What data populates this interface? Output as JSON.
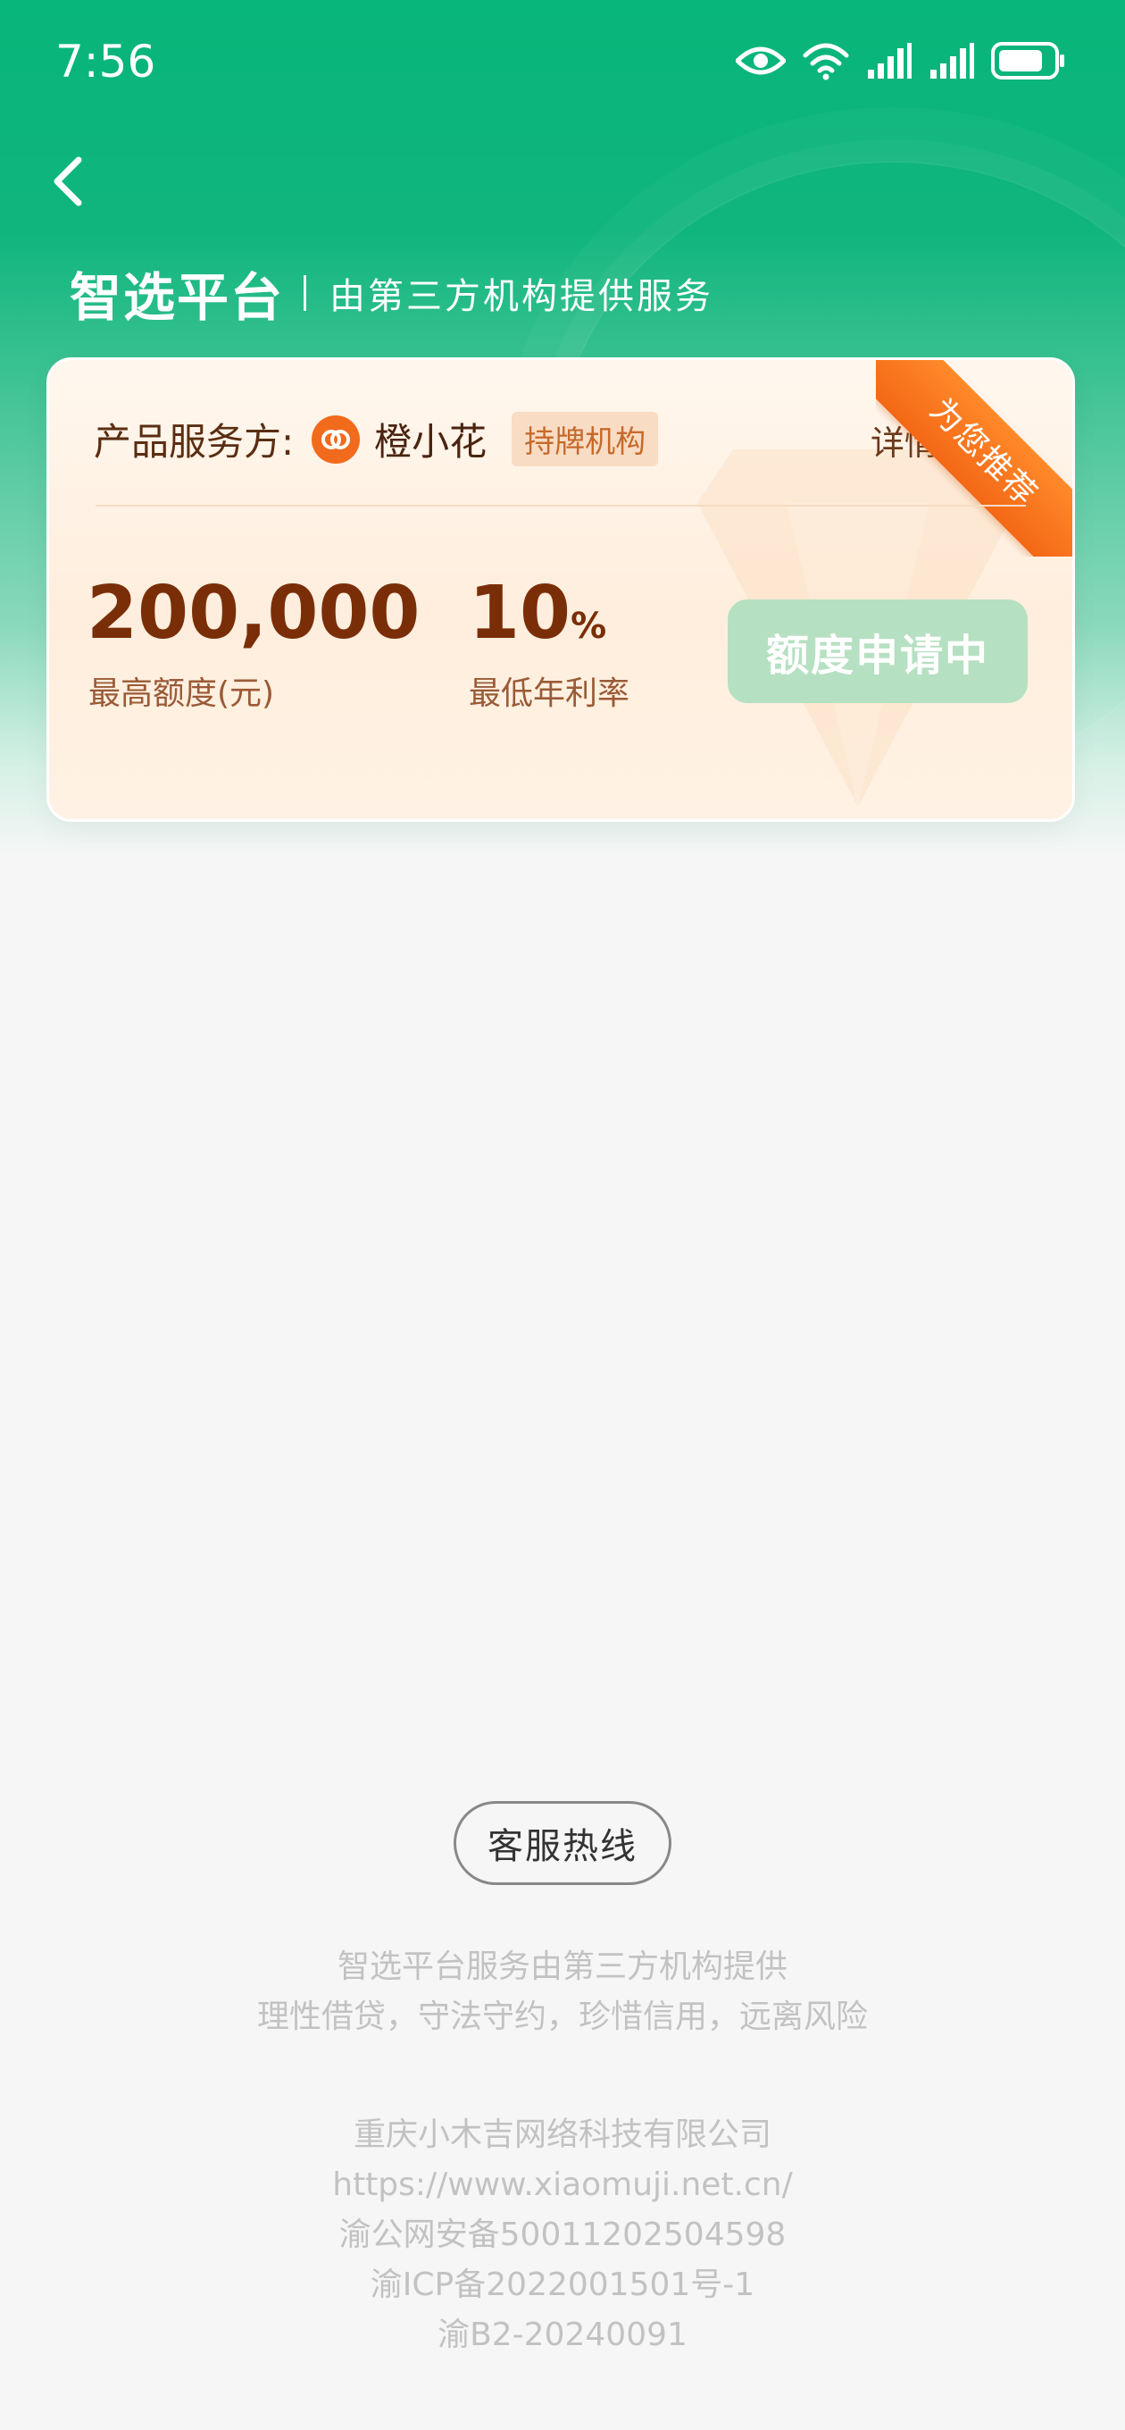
{
  "status_bar": {
    "time": "7:56",
    "icons": [
      "eye-icon",
      "wifi-icon",
      "signal-icon",
      "signal-icon",
      "battery-icon"
    ]
  },
  "header": {
    "back_icon": "chevron-left-icon",
    "brand_title": "智选平台",
    "subtitle": "由第三方机构提供服务"
  },
  "card": {
    "provider_label": "产品服务方:",
    "provider_logo_icon": "brand-logo-icon",
    "provider_name": "橙小花",
    "license_badge": "持牌机构",
    "details_label": "详情",
    "details_icon": "info-icon",
    "ribbon": "为您推荐",
    "max_amount": "200,000",
    "max_amount_label": "最高额度(元)",
    "min_rate_value": "10",
    "min_rate_unit": "%",
    "min_rate_label": "最低年利率",
    "apply_button": "额度申请中"
  },
  "footer": {
    "hotline_button": "客服热线",
    "disclaimer_1": "智选平台服务由第三方机构提供",
    "disclaimer_2": "理性借贷，守法守约，珍惜信用，远离风险",
    "company": "重庆小木吉网络科技有限公司",
    "url": "https://www.xiaomuji.net.cn/",
    "police_record": "渝公网安备50011202504598",
    "icp": "渝ICP备2022001501号-1",
    "b2": "渝B2-20240091"
  },
  "colors": {
    "brand_green": "#08b57a",
    "card_bg": "#fff2e4",
    "amount_text": "#7a2e08",
    "ribbon_orange": "#f46716",
    "apply_button_bg": "#b6e0c2"
  }
}
